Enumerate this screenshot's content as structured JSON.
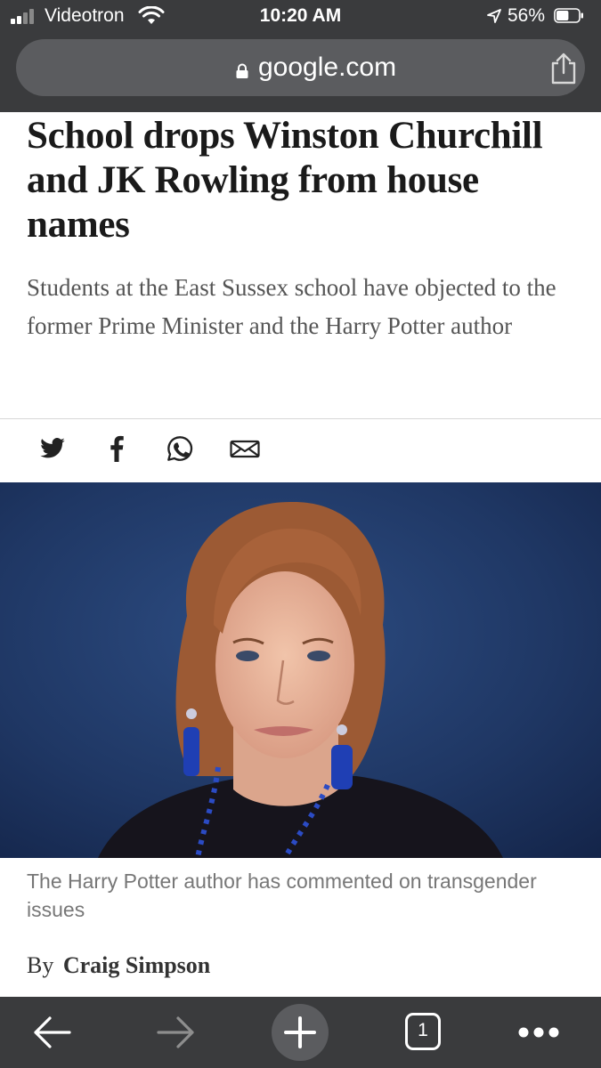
{
  "status_bar": {
    "carrier": "Videotron",
    "time": "10:20 AM",
    "battery_percent": "56%",
    "battery_level": 0.56
  },
  "browser": {
    "url": "google.com"
  },
  "article": {
    "headline": "School drops Winston Churchill and JK Rowling from house names",
    "standfirst": "Students at the East Sussex school have objected to the former Prime Minister and the Harry Potter author",
    "share_icons": [
      "twitter-icon",
      "facebook-icon",
      "whatsapp-icon",
      "email-icon"
    ],
    "caption": "The Harry Potter author has commented on transgender issues",
    "byline_prefix": "By",
    "author": "Craig Simpson"
  },
  "toolbar": {
    "tab_count": "1",
    "icons": [
      "back-arrow-icon",
      "forward-arrow-icon",
      "new-tab-plus-icon",
      "tab-switcher-icon",
      "more-menu-icon"
    ]
  },
  "colors": {
    "chrome": "#3a3b3d",
    "url_field": "#5b5c5f",
    "headline": "#1a1a1a",
    "photo_background": "#1f3560"
  }
}
